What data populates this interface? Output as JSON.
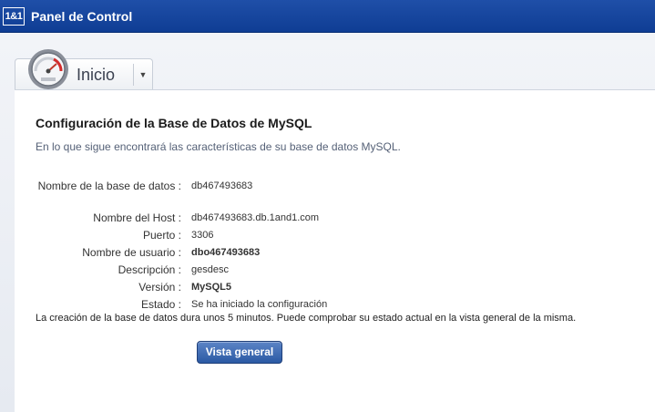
{
  "header": {
    "logo": "1&1",
    "title": "Panel de Control"
  },
  "tab": {
    "label": "Inicio",
    "icon": "gauge-icon"
  },
  "page": {
    "title": "Configuración de la Base de Datos de MySQL",
    "intro": "En lo que sigue encontrará las características de su base de datos MySQL."
  },
  "fields": [
    {
      "label": "Nombre de la base de datos :",
      "value": "db467493683"
    },
    {
      "label": "Nombre del Host :",
      "value": "db467493683.db.1and1.com"
    },
    {
      "label": "Puerto :",
      "value": "3306"
    },
    {
      "label": "Nombre de usuario :",
      "value": "dbo467493683"
    },
    {
      "label": "Descripción :",
      "value": "gesdesc"
    },
    {
      "label": "Versión :",
      "value": "MySQL5"
    },
    {
      "label": "Estado :",
      "value": "Se ha iniciado la configuración"
    }
  ],
  "note": "La creación de la base de datos dura unos 5 minutos. Puede comprobar su estado actual en la vista general de la misma.",
  "button": {
    "label": "Vista general"
  },
  "colors": {
    "header_blue": "#1f4fa8",
    "button_blue": "#2b5aa4"
  }
}
